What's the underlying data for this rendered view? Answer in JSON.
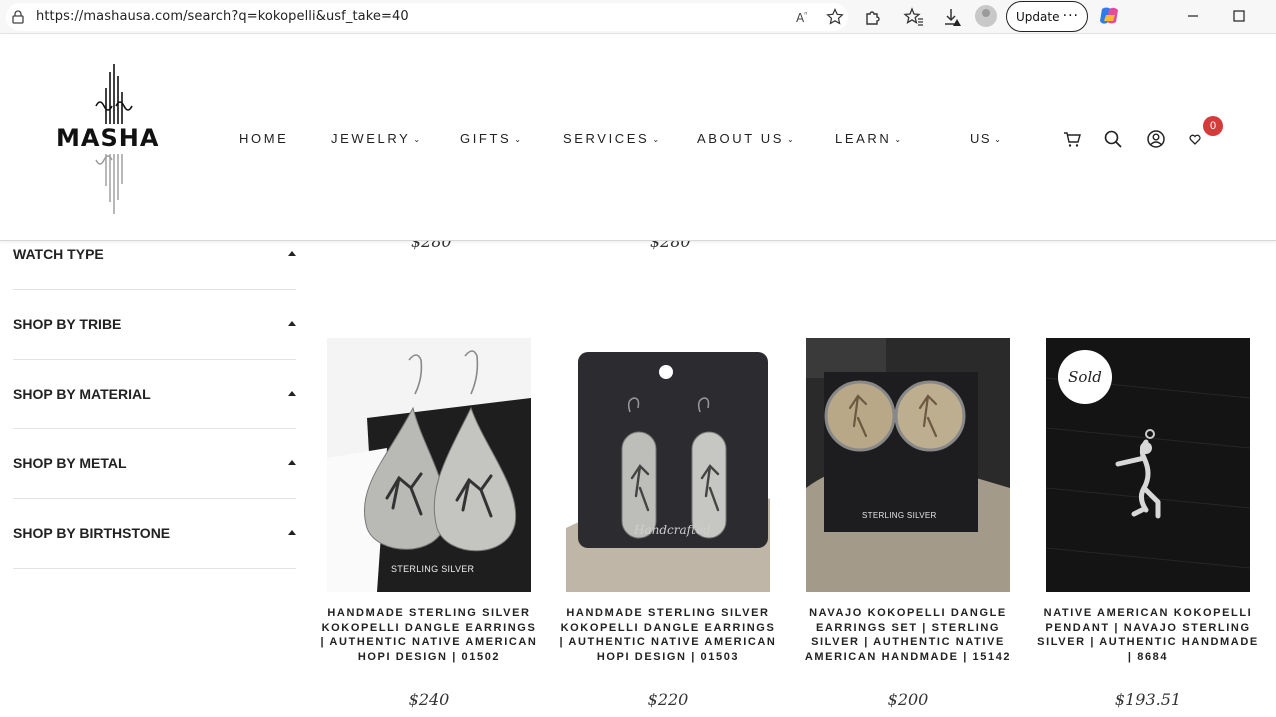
{
  "browser": {
    "url": "https://mashausa.com/search?q=kokopelli&usf_take=40",
    "update_label": "Update",
    "more_label": "···"
  },
  "header": {
    "logo_text": "MASHA",
    "nav": [
      {
        "label": "HOME",
        "has_dropdown": false
      },
      {
        "label": "JEWELRY",
        "has_dropdown": true
      },
      {
        "label": "GIFTS",
        "has_dropdown": true
      },
      {
        "label": "SERVICES",
        "has_dropdown": true
      },
      {
        "label": "ABOUT US",
        "has_dropdown": true
      },
      {
        "label": "LEARN",
        "has_dropdown": true
      }
    ],
    "currency": "US",
    "cart_count": "0"
  },
  "sidebar": {
    "filters": [
      {
        "label": "WATCH TYPE"
      },
      {
        "label": "SHOP BY TRIBE"
      },
      {
        "label": "SHOP BY MATERIAL"
      },
      {
        "label": "SHOP BY METAL"
      },
      {
        "label": "SHOP BY BIRTHSTONE"
      }
    ]
  },
  "previous_row_prices": [
    "$280",
    "$280"
  ],
  "products": [
    {
      "title": "HANDMADE STERLING SILVER KOKOPELLI DANGLE EARRINGS | AUTHENTIC NATIVE AMERICAN HOPI DESIGN | 01502",
      "price": "$240",
      "sold": false,
      "image_text": "STERLING SILVER"
    },
    {
      "title": "HANDMADE STERLING SILVER KOKOPELLI DANGLE EARRINGS | AUTHENTIC NATIVE AMERICAN HOPI DESIGN | 01503",
      "price": "$220",
      "sold": false,
      "image_text": "Handcrafted"
    },
    {
      "title": "NAVAJO KOKOPELLI DANGLE EARRINGS SET | STERLING SILVER | AUTHENTIC NATIVE AMERICAN HANDMADE | 15142",
      "price": "$200",
      "sold": false,
      "image_text": "STERLING SILVER"
    },
    {
      "title": "NATIVE AMERICAN KOKOPELLI PENDANT | NAVAJO STERLING SILVER | AUTHENTIC HANDMADE | 8684",
      "price": "$193.51",
      "sold": true,
      "sold_label": "Sold"
    }
  ]
}
